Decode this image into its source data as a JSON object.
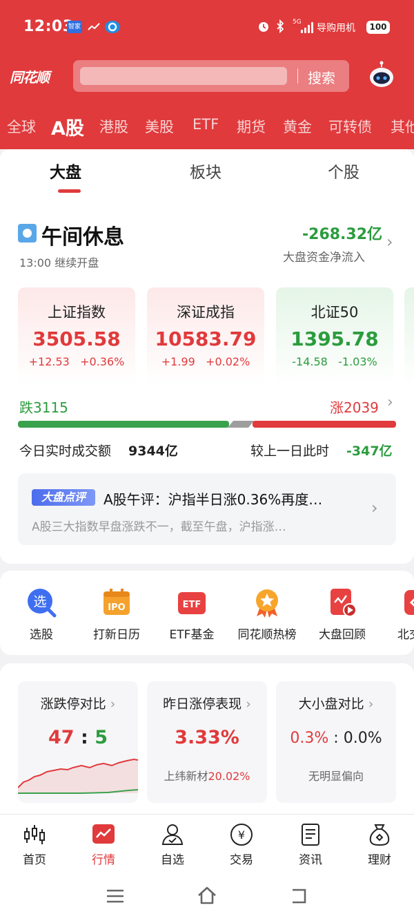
{
  "status_bar": {
    "time": "12:03",
    "mini_apps": [
      "智家",
      "",
      ""
    ],
    "network": "5G",
    "carrier": "导购用机",
    "battery": "100"
  },
  "header": {
    "logo": "同花顺",
    "search_button": "搜索",
    "market_tabs": [
      "全球",
      "A股",
      "港股",
      "美股",
      "ETF",
      "期货",
      "黄金",
      "可转债",
      "其他"
    ],
    "active_market_tab": "A股"
  },
  "sub_tabs": [
    "大盘",
    "板块",
    "个股"
  ],
  "market_status": {
    "title": "午间休息",
    "subtitle": "13:00 继续开盘",
    "net_flow_value": "-268.32亿",
    "net_flow_label": "大盘资金净流入"
  },
  "indices": [
    {
      "name": "上证指数",
      "value": "3505.58",
      "change": "+12.53",
      "pct": "+0.36%",
      "trend": "up"
    },
    {
      "name": "深证成指",
      "value": "10583.79",
      "change": "+1.99",
      "pct": "+0.02%",
      "trend": "up"
    },
    {
      "name": "北证50",
      "value": "1395.78",
      "change": "-14.58",
      "pct": "-1.03%",
      "trend": "down"
    }
  ],
  "breadth": {
    "fall": "跌3115",
    "rise": "涨2039",
    "fall_count": 3115,
    "rise_count": 2039,
    "volume_label": "今日实时成交额",
    "volume_value": "9344亿",
    "compare_label": "较上一日此时",
    "compare_value": "-347亿"
  },
  "commentary": {
    "badge": "大盘点评",
    "title": "A股午评：沪指半日涨0.36%再度…",
    "body": "A股三大指数早盘涨跌不一，截至午盘，沪指涨…"
  },
  "shortcuts": [
    {
      "label": "选股",
      "icon": "stock-picker-icon"
    },
    {
      "label": "打新日历",
      "icon": "ipo-calendar-icon"
    },
    {
      "label": "ETF基金",
      "icon": "etf-fund-icon"
    },
    {
      "label": "同花顺热榜",
      "icon": "hot-list-icon"
    },
    {
      "label": "大盘回顾",
      "icon": "market-review-icon"
    },
    {
      "label": "北交所",
      "icon": "bse-icon"
    }
  ],
  "stats": {
    "limit_ratio": {
      "title": "涨跌停对比",
      "up": "47",
      "sep": ":",
      "down": "5"
    },
    "yesterday_limit": {
      "title": "昨日涨停表现",
      "value": "3.33%",
      "note_name": "上纬新材",
      "note_value": "20.02%"
    },
    "cap_compare": {
      "title": "大小盘对比",
      "left": "0.3%",
      "sep": ":",
      "right": "0.0%",
      "note": "无明显偏向"
    }
  },
  "bottom_nav": [
    {
      "label": "首页",
      "icon": "candlestick-icon"
    },
    {
      "label": "行情",
      "icon": "market-chart-icon"
    },
    {
      "label": "自选",
      "icon": "watchlist-user-icon"
    },
    {
      "label": "交易",
      "icon": "yuan-coin-icon"
    },
    {
      "label": "资讯",
      "icon": "news-doc-icon"
    },
    {
      "label": "理财",
      "icon": "money-bag-icon"
    }
  ],
  "active_nav": "行情",
  "colors": {
    "brand_red": "#e03a3c",
    "fall_green": "#2b9c3e",
    "neutral_gray": "#999999"
  }
}
